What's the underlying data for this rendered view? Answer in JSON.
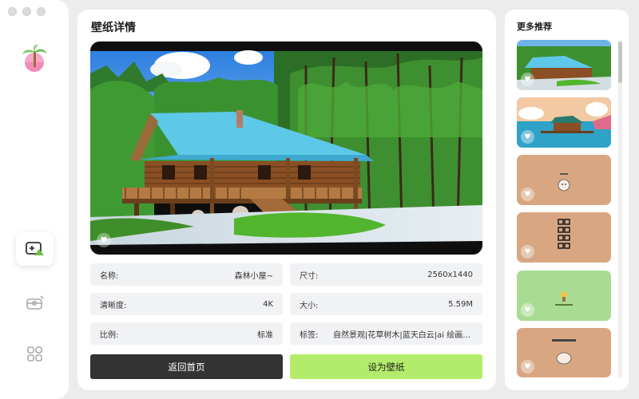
{
  "window": {
    "controls": [
      "close",
      "minimize",
      "maximize"
    ]
  },
  "sidebar": {
    "logo_icon": "palm-tree-logo",
    "items": [
      {
        "icon": "wallpaper-add-icon",
        "active": true
      },
      {
        "icon": "box-icon",
        "active": false
      },
      {
        "icon": "grid-apps-icon",
        "active": false
      }
    ]
  },
  "main": {
    "title": "壁纸详情",
    "preview_like_icon": "heart-icon",
    "info": {
      "name_label": "名称:",
      "name_value": "森林小屋~",
      "size_label": "尺寸:",
      "size_value": "2560x1440",
      "clarity_label": "清晰度:",
      "clarity_value": "4K",
      "filesize_label": "大小:",
      "filesize_value": "5.59M",
      "ratio_label": "比例:",
      "ratio_value": "标准",
      "tags_label": "标签:",
      "tags_value": "自然景观|花草树木|蓝天白云|ai 绘画|..."
    },
    "back_button": "返回首页",
    "set_button": "设为壁纸",
    "colors": {
      "set_button_bg": "#b3ec6b",
      "back_button_bg": "#333333"
    }
  },
  "recommend": {
    "title": "更多推荐",
    "thumbs": [
      {
        "name": "forest-cabin-thumb"
      },
      {
        "name": "lake-hut-thumb"
      },
      {
        "name": "cartoon-bear-thumb"
      },
      {
        "name": "calligraphy-thumb"
      },
      {
        "name": "green-sketch-thumb"
      },
      {
        "name": "cartoon-note-thumb"
      }
    ]
  }
}
